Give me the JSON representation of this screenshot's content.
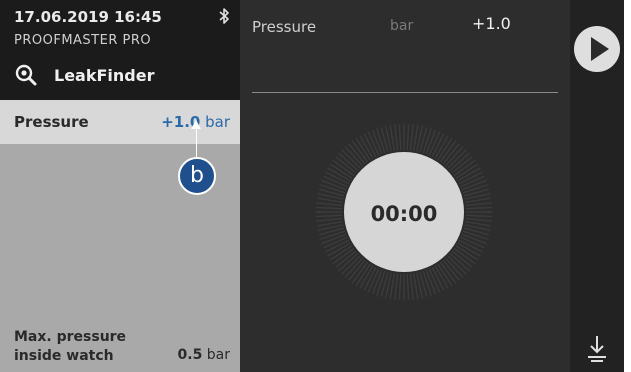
{
  "header": {
    "datetime": "17.06.2019 16:45",
    "device_name": "PROOFMASTER PRO",
    "mode_label": "LeakFinder"
  },
  "left_panel": {
    "pressure_row": {
      "label": "Pressure",
      "value": "+1.0",
      "unit": " bar"
    },
    "max_pressure": {
      "label_line1": "Max. pressure",
      "label_line2": "inside watch",
      "value": "0.5",
      "unit": " bar"
    },
    "callout_badge": "b"
  },
  "main_panel": {
    "label": "Pressure",
    "unit": "bar",
    "value": "+1.0",
    "timer": "00:00"
  },
  "icons": {
    "bluetooth": "bluetooth-icon",
    "leakfinder": "leak-search-icon",
    "play": "play-icon",
    "download": "download-icon"
  },
  "colors": {
    "accent_blue": "#2a6aa8",
    "badge_blue": "#1f4f8c",
    "selected_row": "#d8d8d8",
    "left_body": "#a9a9a9",
    "background": "#2d2d2d"
  }
}
